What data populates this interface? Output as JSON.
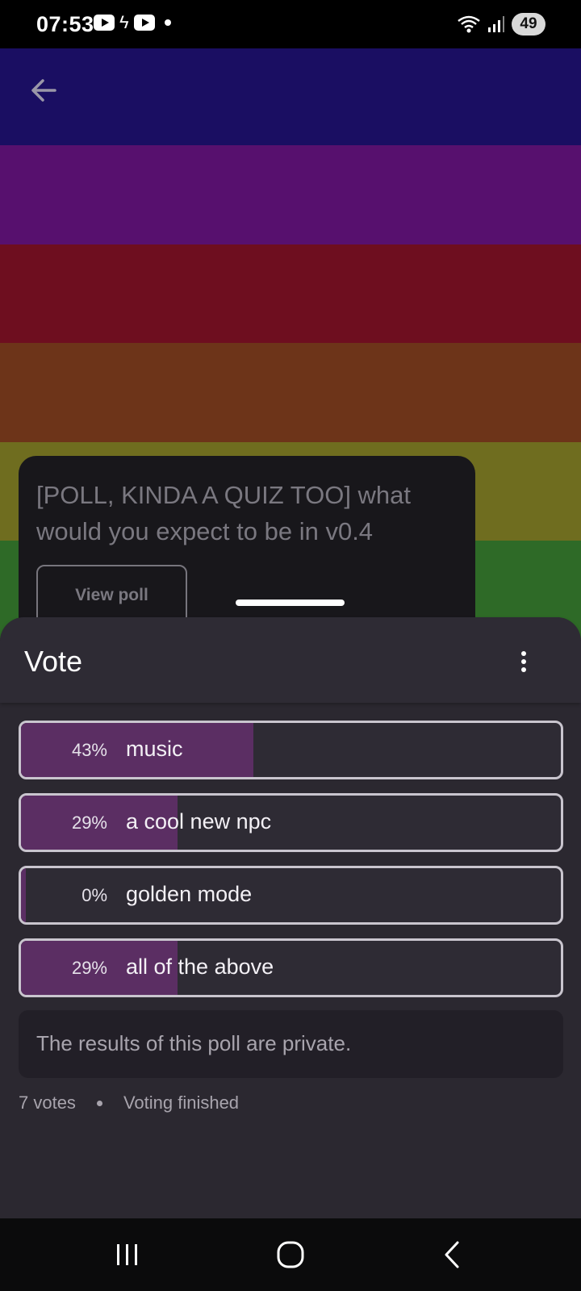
{
  "status_bar": {
    "time": "07:53",
    "battery": "49",
    "icons": [
      "youtube-icon",
      "bolt-icon",
      "youtube-icon",
      "notification-dot-icon",
      "wifi-icon",
      "signal-icon"
    ]
  },
  "header": {
    "back_icon": "arrow-left-icon",
    "stripe_colors": [
      "#1a0e62",
      "#57106e",
      "#6e0e1f",
      "#6d3419",
      "#6f6d1f",
      "#2e6a27"
    ]
  },
  "post": {
    "title": "[POLL, KINDA A QUIZ TOO] what would you expect to be in v0.4",
    "view_poll_label": "View poll"
  },
  "sheet": {
    "title": "Vote",
    "menu_icon": "more-vertical-icon",
    "options": [
      {
        "percent": "43%",
        "label": "music",
        "fraction": 0.43
      },
      {
        "percent": "29%",
        "label": "a cool new npc",
        "fraction": 0.29
      },
      {
        "percent": "0%",
        "label": "golden mode",
        "fraction": 0.0
      },
      {
        "percent": "29%",
        "label": "all of the above",
        "fraction": 0.29
      }
    ],
    "private_notice": "The results of this poll are private.",
    "votes": "7 votes",
    "status": "Voting finished"
  },
  "navbar": {
    "icons": [
      "recent-apps-icon",
      "home-icon",
      "back-icon"
    ]
  },
  "colors": {
    "accent_fill": "#5b2e63",
    "sheet_bg": "#2b2830"
  }
}
